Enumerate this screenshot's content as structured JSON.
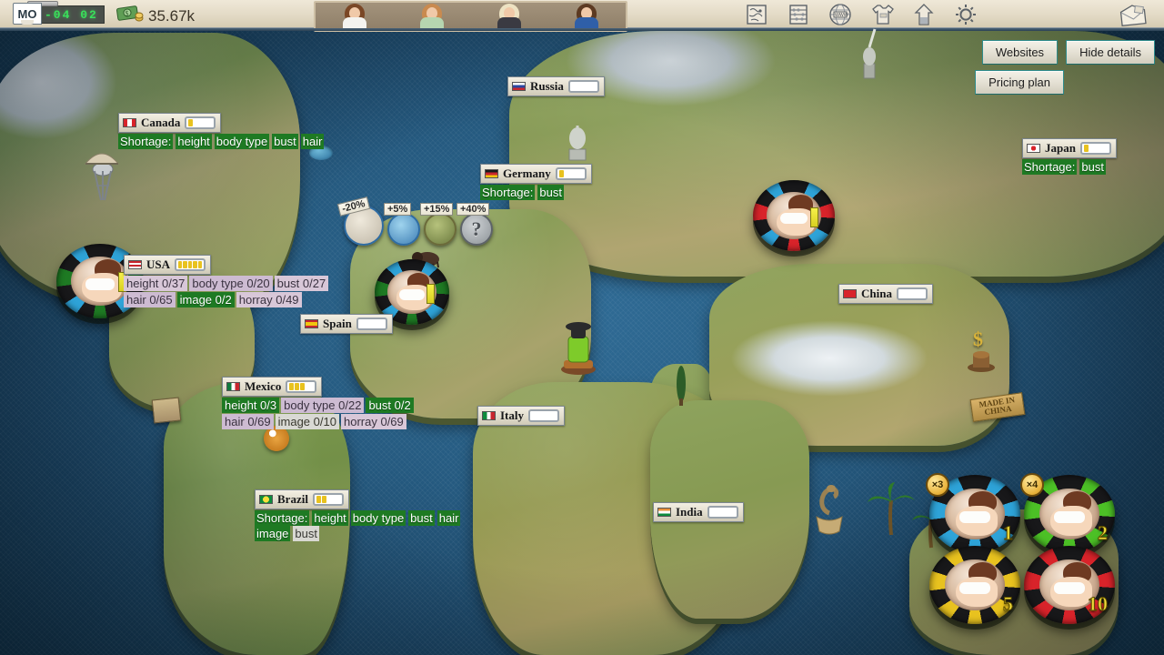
{
  "hud": {
    "calendar": {
      "month_label": "MO",
      "lcd_value": "-04 02",
      "icon": "calendar-icon"
    },
    "money": {
      "icon": "cash-icon",
      "amount": "35.67k"
    },
    "portraits": [
      {
        "name": "girl-1",
        "hair": "#7a4726",
        "outfit": "#f4f3ef"
      },
      {
        "name": "girl-2",
        "hair": "#c98a4f",
        "outfit": "#b6d6b0"
      },
      {
        "name": "girl-3",
        "hair": "#ede2c2",
        "outfit": "#3a3a42"
      },
      {
        "name": "girl-4",
        "hair": "#5c3a22",
        "outfit": "#2f5fa8"
      }
    ],
    "icons": [
      {
        "name": "map-icon",
        "label": "Map"
      },
      {
        "name": "abacus-icon",
        "label": "Finance"
      },
      {
        "name": "globe-www-icon",
        "label": "Websites"
      },
      {
        "name": "tshirt-icon",
        "label": "Wardrobe"
      },
      {
        "name": "building-icon",
        "label": "Studio"
      },
      {
        "name": "gear-icon",
        "label": "Settings"
      }
    ],
    "mail_icon": {
      "name": "mail-icon",
      "label": "Mail"
    }
  },
  "buttons": {
    "websites": "Websites",
    "hide_details": "Hide details",
    "pricing_plan": "Pricing plan"
  },
  "modifiers": [
    {
      "name": "paper-modifier",
      "value": "-20%",
      "icon": "paper-stack-icon"
    },
    {
      "name": "bed-modifier",
      "value": "+5%",
      "icon": "bed-icon"
    },
    {
      "name": "village-modifier",
      "value": "+15%",
      "icon": "village-icon"
    },
    {
      "name": "unknown-modifier",
      "value": "+40%",
      "icon": "question-mark-icon"
    }
  ],
  "countries": [
    {
      "id": "canada",
      "name": "Canada",
      "bars": 1,
      "flag": [
        "#d8232a",
        "#ffffff",
        "#d8232a"
      ],
      "shortage_label": "Shortage:",
      "shortage": [
        "height",
        "body type",
        "bust",
        "hair"
      ],
      "stats": []
    },
    {
      "id": "usa",
      "name": "USA",
      "bars": 5,
      "flag": [
        "#3b4a8c",
        "#ffffff",
        "#c8262e"
      ],
      "shortage_label": "",
      "shortage": [],
      "stats": [
        [
          {
            "k": "height",
            "v": "0/37",
            "style": "pink"
          },
          {
            "k": "body type",
            "v": "0/20",
            "style": "pink2"
          },
          {
            "k": "bust",
            "v": "0/27",
            "style": "pink"
          }
        ],
        [
          {
            "k": "hair",
            "v": "0/65",
            "style": "pink2"
          },
          {
            "k": "image",
            "v": "0/2",
            "style": "green"
          },
          {
            "k": "horray",
            "v": "0/49",
            "style": "pink"
          }
        ]
      ]
    },
    {
      "id": "mexico",
      "name": "Mexico",
      "bars": 3,
      "flag": [
        "#0e7a3c",
        "#ffffff",
        "#c8262e"
      ],
      "shortage_label": "",
      "shortage": [],
      "stats": [
        [
          {
            "k": "height",
            "v": "0/3",
            "style": "green"
          },
          {
            "k": "body type",
            "v": "0/22",
            "style": "pink2"
          },
          {
            "k": "bust",
            "v": "0/2",
            "style": "green"
          }
        ],
        [
          {
            "k": "hair",
            "v": "0/69",
            "style": "pink2"
          },
          {
            "k": "image",
            "v": "0/10",
            "style": "gray"
          },
          {
            "k": "horray",
            "v": "0/69",
            "style": "pink"
          }
        ]
      ]
    },
    {
      "id": "brazil",
      "name": "Brazil",
      "bars": 2,
      "flag": [
        "#0e8b3d",
        "#f8e03c",
        "#0e8b3d"
      ],
      "shortage_label": "Shortage:",
      "shortage": [
        "height",
        "body type",
        "bust",
        "hair",
        "image",
        "bust"
      ],
      "stats": []
    },
    {
      "id": "russia",
      "name": "Russia",
      "bars": 0,
      "flag": [
        "#ffffff",
        "#2b48a0",
        "#c8262e"
      ],
      "shortage_label": "",
      "shortage": [],
      "stats": []
    },
    {
      "id": "germany",
      "name": "Germany",
      "bars": 1,
      "flag": [
        "#1a1a1a",
        "#c8262e",
        "#f1c40f"
      ],
      "shortage_label": "Shortage:",
      "shortage": [
        "bust"
      ],
      "stats": []
    },
    {
      "id": "spain",
      "name": "Spain",
      "bars": 0,
      "flag": [
        "#c8262e",
        "#f1c40f",
        "#c8262e"
      ],
      "shortage_label": "",
      "shortage": [],
      "stats": []
    },
    {
      "id": "italy",
      "name": "Italy",
      "bars": 0,
      "flag": [
        "#0e8b3d",
        "#ffffff",
        "#c8262e"
      ],
      "shortage_label": "",
      "shortage": [],
      "stats": []
    },
    {
      "id": "japan",
      "name": "Japan",
      "bars": 1,
      "flag": [
        "#ffffff",
        "#d8232a",
        "#ffffff"
      ],
      "shortage_label": "Shortage:",
      "shortage": [
        "bust"
      ],
      "stats": []
    },
    {
      "id": "china",
      "name": "China",
      "bars": 0,
      "flag": [
        "#d8232a",
        "#f1c40f",
        "#d8232a"
      ],
      "shortage_label": "",
      "shortage": [],
      "stats": []
    },
    {
      "id": "india",
      "name": "India",
      "bars": 0,
      "flag": [
        "#e8913a",
        "#ffffff",
        "#0e8b3d"
      ],
      "shortage_label": "",
      "shortage": [],
      "stats": []
    }
  ],
  "map_tokens": [
    {
      "name": "casino-token-usa",
      "ring1": "#2ea3d8",
      "ring2": "#1e7a23"
    },
    {
      "name": "casino-token-europe",
      "ring1": "#2ea3d8",
      "ring2": "#1e7a23"
    },
    {
      "name": "casino-token-asia",
      "ring1": "#2ea3d8",
      "ring2": "#d8232a"
    }
  ],
  "tray_chips": [
    {
      "name": "chip-1",
      "number": "1",
      "multiplier": "×3",
      "ring1": "#2ea3d8",
      "ring2": "#2ea3d8"
    },
    {
      "name": "chip-2",
      "number": "2",
      "multiplier": "×4",
      "ring1": "#4cc026",
      "ring2": "#4cc026"
    },
    {
      "name": "chip-5",
      "number": "5",
      "multiplier": "",
      "ring1": "#e8c21f",
      "ring2": "#e8c21f"
    },
    {
      "name": "chip-10",
      "number": "10",
      "multiplier": "",
      "ring1": "#d8232a",
      "ring2": "#d8232a"
    }
  ],
  "decorations": [
    {
      "name": "made-in-china-sign",
      "line1": "MADE IN",
      "line2": "CHINA"
    }
  ]
}
